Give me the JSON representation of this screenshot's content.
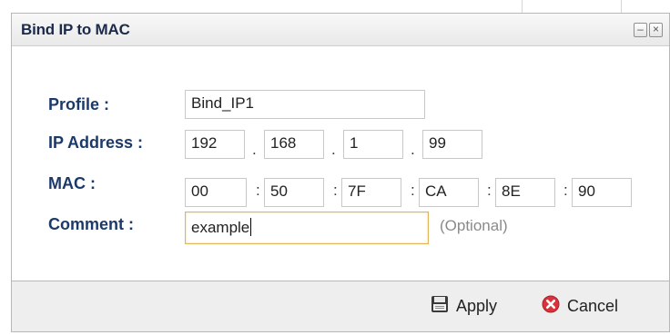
{
  "dialog": {
    "title": "Bind IP to MAC",
    "minimize_icon": "minimize-icon",
    "close_icon": "close-icon"
  },
  "form": {
    "profile_label": "Profile :",
    "profile_value": "Bind_IP1",
    "ip_label": "IP Address :",
    "ip_octets": [
      "192",
      "168",
      "1",
      "99"
    ],
    "ip_separator": ".",
    "mac_label": "MAC :",
    "mac_octets": [
      "00",
      "50",
      "7F",
      "CA",
      "8E",
      "90"
    ],
    "mac_separator": ":",
    "comment_label": "Comment :",
    "comment_value": "example",
    "comment_hint": "(Optional)"
  },
  "footer": {
    "apply_label": "Apply",
    "apply_icon": "save-icon",
    "cancel_label": "Cancel",
    "cancel_icon": "cancel-icon"
  },
  "colors": {
    "label_text": "#1b3a6b",
    "active_field_border": "#e0b45a",
    "cancel_icon_red": "#d9333b"
  }
}
